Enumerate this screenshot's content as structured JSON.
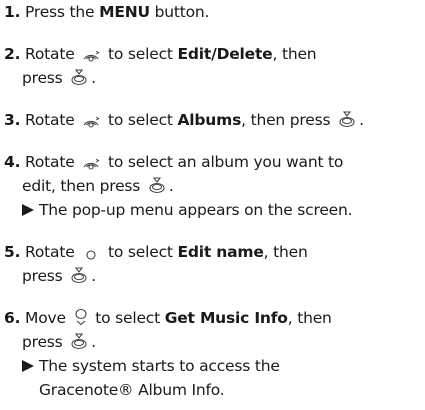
{
  "icons": {
    "rotate": "rotate-dial-icon",
    "press": "press-dial-icon",
    "move": "joystick-move-icon",
    "result": "triangle-arrow-icon"
  },
  "steps": [
    {
      "number": "1.",
      "text_a": "Press the ",
      "bold_a": "MENU",
      "text_b": " button."
    },
    {
      "number": "2.",
      "text_a": "Rotate",
      "text_b": "to select ",
      "bold_a": "Edit/Delete",
      "text_c": ", then",
      "text_d": "press",
      "text_e": "."
    },
    {
      "number": "3.",
      "text_a": "Rotate",
      "text_b": "to select ",
      "bold_a": "Albums",
      "text_c": ", then press",
      "text_d": "."
    },
    {
      "number": "4.",
      "text_a": "Rotate",
      "text_b": "to select an album you want to",
      "text_c": "edit, then press",
      "text_d": ".",
      "result": "The pop-up menu appears on the screen."
    },
    {
      "number": "5.",
      "text_a": "Rotate",
      "text_b": "to select ",
      "bold_a": "Edit name",
      "text_c": ", then",
      "text_d": "press",
      "text_e": "."
    },
    {
      "number": "6.",
      "text_a": "Move",
      "text_b": "to select ",
      "bold_a": "Get Music Info",
      "text_c": ", then",
      "text_d": "press",
      "text_e": ".",
      "result_a": "The system starts to access the",
      "result_b": "Gracenote® Album Info."
    }
  ]
}
